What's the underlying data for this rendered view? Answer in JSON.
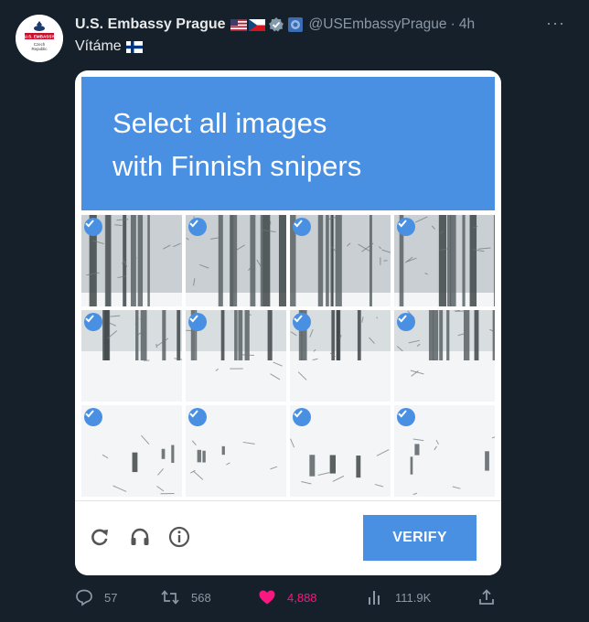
{
  "tweet": {
    "display_name": "U.S. Embassy Prague",
    "handle": "@USEmbassyPrague",
    "separator": "·",
    "time": "4h",
    "text": "Vítáme",
    "more_label": "···",
    "avatar": {
      "line1": "U.S. EMBASSY",
      "line2": "Czech",
      "line3": "Republic"
    }
  },
  "captcha": {
    "prompt_line1": "Select all images",
    "prompt_line2": "with Finnish snipers",
    "verify_label": "VERIFY",
    "tiles_selected": 12,
    "icons": [
      "reload-icon",
      "headphones-icon",
      "info-icon"
    ]
  },
  "actions": {
    "replies": "57",
    "retweets": "568",
    "likes": "4,888",
    "views": "111.9K"
  },
  "colors": {
    "background": "#15202b",
    "captcha_blue": "#4a90e2",
    "like_pink": "#f91880",
    "muted": "#8b98a5"
  }
}
